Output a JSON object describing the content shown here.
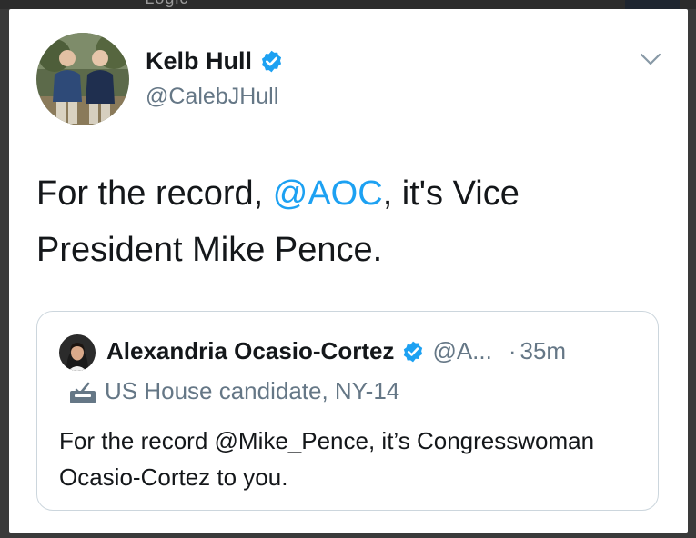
{
  "colors": {
    "link": "#1da1f2",
    "verified": "#1da1f2",
    "secondary_text": "#657786",
    "primary_text": "#14171a",
    "border": "#ccd6dd"
  },
  "top_strip": {
    "text": "\"Logic\""
  },
  "tweet": {
    "author": {
      "display_name": "Kelb Hull",
      "handle": "@CalebJHull",
      "verified": true,
      "avatar_icon": "avatar-photo"
    },
    "menu_icon": "chevron-down-icon",
    "text_before": "For the record, ",
    "mention": "@AOC",
    "text_after": ", it's Vice President Mike Pence."
  },
  "quoted_tweet": {
    "author": {
      "display_name": "Alexandria Ocasio-Cortez",
      "handle_truncated": "@A...",
      "verified": true,
      "avatar_icon": "avatar-photo"
    },
    "separator": "·",
    "time": "35m",
    "label_icon": "ballot-box-icon",
    "label": "US House candidate, NY-14",
    "text": "For the record @Mike_Pence, it’s Congresswoman Ocasio-Cortez to you."
  }
}
